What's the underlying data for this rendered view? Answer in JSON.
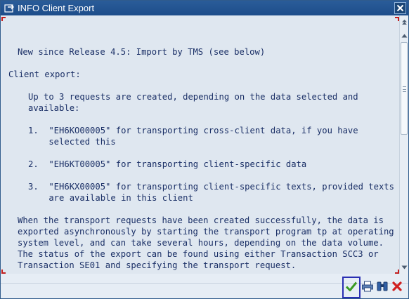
{
  "window": {
    "title": "INFO Client Export"
  },
  "content": {
    "lines": [
      {
        "text": "New since Release 4.5: Import by TMS (see below)"
      },
      {
        "text": "Client export:"
      },
      {
        "text": "Up to 3 requests are created, depending on the data selected and"
      },
      {
        "text": "available:"
      },
      {
        "text": "1.  \"EH6KO00005\" for transporting cross-client data, if you have"
      },
      {
        "text": "    selected this"
      },
      {
        "text": "2.  \"EH6KT00005\" for transporting client-specific data"
      },
      {
        "text": "3.  \"EH6KX00005\" for transporting client-specific texts, provided texts"
      },
      {
        "text": "    are available in this client"
      },
      {
        "text": "When the transport requests have been created successfully, the data is"
      },
      {
        "text": "exported asynchronously by starting the transport program tp at operating"
      },
      {
        "text": "system level, and can take several hours, depending on the data volume."
      },
      {
        "text": "The status of the export can be found using either Transaction SCC3 or"
      },
      {
        "text": "Transaction SE01 and specifying the transport request."
      }
    ]
  },
  "footer": {
    "buttons": [
      {
        "name": "continue",
        "icon": "checkmark-icon"
      },
      {
        "name": "print",
        "icon": "printer-icon"
      },
      {
        "name": "find",
        "icon": "binoculars-icon"
      },
      {
        "name": "cancel",
        "icon": "red-x-icon"
      }
    ]
  },
  "colors": {
    "text": "#1a2f66",
    "title_bar": "#1d4d8a",
    "corner_marks": "#c21e1e",
    "focus_border": "#2a2fb3"
  }
}
